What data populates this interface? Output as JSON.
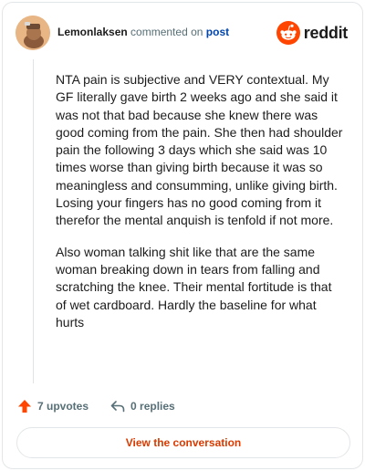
{
  "header": {
    "username": "Lemonlaksen",
    "action_text": "commented on",
    "target": "post",
    "logo_text": "reddit",
    "brand_color": "#ff4500"
  },
  "comment": {
    "paragraphs": [
      "NTA pain is subjective and VERY contextual. My GF literally gave birth 2 weeks ago and she said it was not that bad because she knew there was good coming from the pain. She then had shoulder pain the following 3 days which she said was 10 times worse than giving birth because it was so meaningless and consumming, unlike giving birth. Losing your fingers has no good coming from it therefor the mental anquish is tenfold if not more.",
      "Also woman talking shit like that are the same woman breaking down in tears from falling and scratching the knee. Their mental fortitude is that of wet cardboard. Hardly the baseline for what hurts"
    ]
  },
  "actions": {
    "upvotes": "7 upvotes",
    "replies": "0 replies",
    "upvote_color": "#ff4500"
  },
  "footer": {
    "view_button": "View the conversation"
  }
}
